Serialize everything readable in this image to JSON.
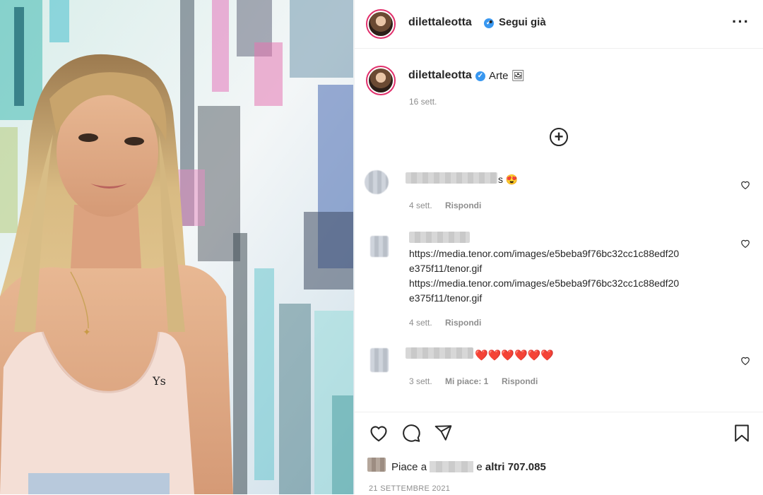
{
  "colors": {
    "accent": "#3897f0",
    "story_ring": "#e1306c",
    "heart": "#ed4956",
    "muted": "#8e8e8e",
    "text": "#262626"
  },
  "header": {
    "username": "dilettaleotta",
    "separator": "•",
    "follow_label": "Segui già",
    "more_icon": "ellipsis-icon"
  },
  "caption": {
    "username": "dilettaleotta",
    "text": "Arte 🖼",
    "time": "16 sett."
  },
  "load_more_icon": "plus-circle-icon",
  "comments": [
    {
      "text": "s 😍",
      "time": "4 sett.",
      "reply_label": "Rispondi"
    },
    {
      "lines": [
        "https://media.tenor.com/images/e5beba9f76bc32cc1c88edf20",
        "e375f11/tenor.gif",
        "https://media.tenor.com/images/e5beba9f76bc32cc1c88edf20",
        "e375f11/tenor.gif"
      ],
      "time": "4 sett.",
      "reply_label": "Rispondi"
    },
    {
      "text": "❤️❤️❤️❤️❤️❤️",
      "time": "3 sett.",
      "likes_label": "Mi piace: 1",
      "reply_label": "Rispondi"
    }
  ],
  "actions": {
    "icons": [
      "heart-icon",
      "comment-icon",
      "share-icon",
      "bookmark-icon"
    ],
    "likes_prefix": "Piace a",
    "likes_suffix": "e",
    "likes_count": "altri 707.085",
    "date": "21 SETTEMBRE 2021"
  }
}
